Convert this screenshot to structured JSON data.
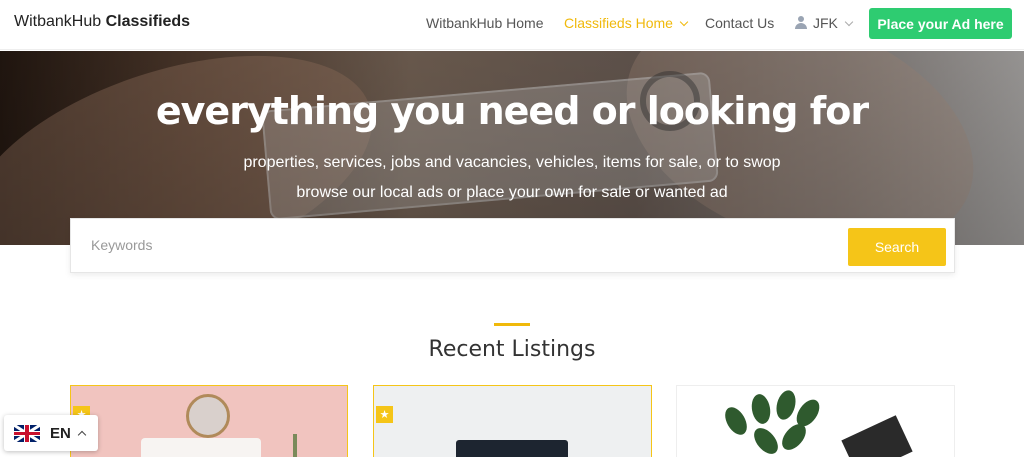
{
  "header": {
    "brand_light": "WitbankHub ",
    "brand_bold": "Classifieds",
    "nav": [
      {
        "label": "WitbankHub Home"
      },
      {
        "label": "Classifieds Home"
      },
      {
        "label": "Contact Us"
      },
      {
        "label": "JFK"
      }
    ],
    "cta_label": "Place your Ad here",
    "active_color": "#f0b90b",
    "cta_color": "#2ecc71"
  },
  "hero": {
    "title": "everything you need or looking for",
    "subtitle_1": "properties, services, jobs and vacancies, vehicles, items for sale, or to swop",
    "subtitle_2": "browse our local ads or place your own for sale or wanted ad"
  },
  "search": {
    "placeholder": "Keywords",
    "value": "",
    "button_label": "Search",
    "button_color": "#f5c518"
  },
  "section": {
    "title": "Recent Listings"
  },
  "listings": [
    {
      "featured": true
    },
    {
      "featured": true
    },
    {
      "featured": false
    }
  ],
  "language": {
    "code": "EN"
  }
}
